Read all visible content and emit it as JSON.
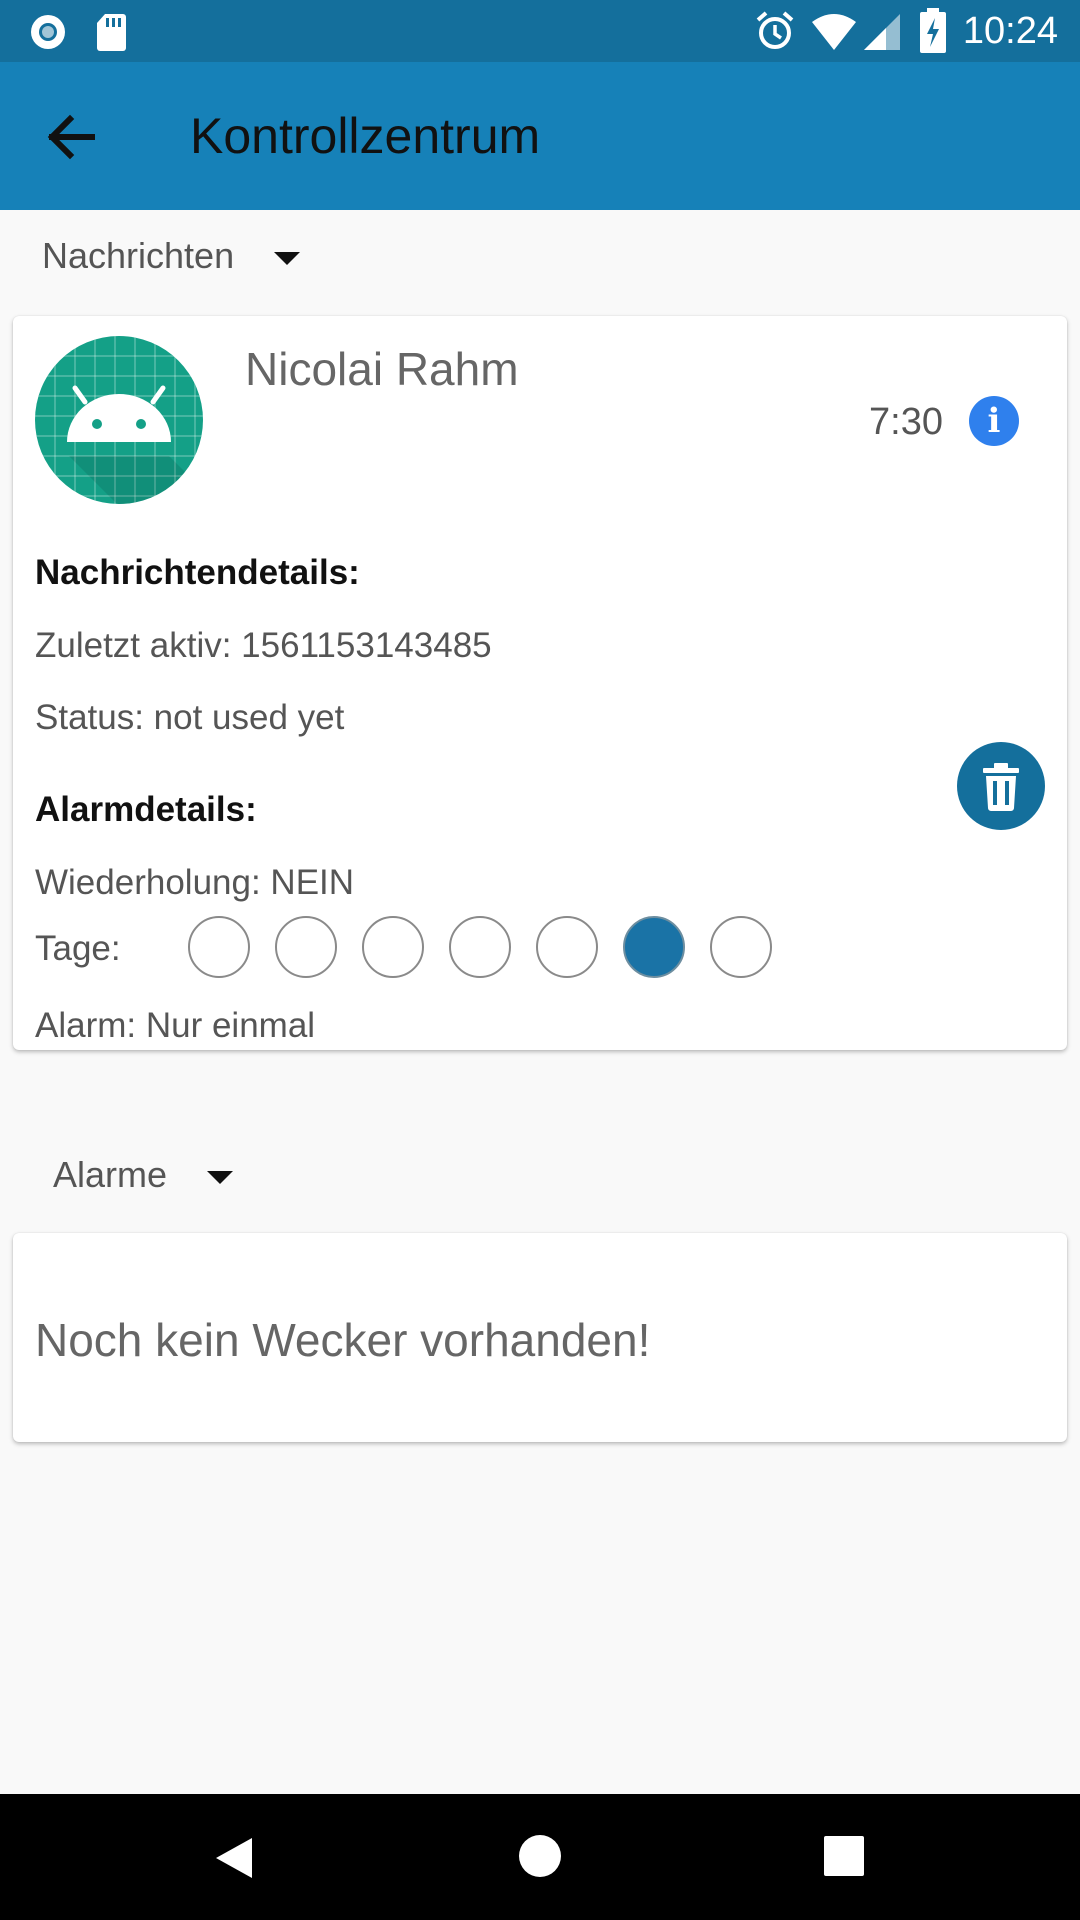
{
  "statusbar": {
    "time": "10:24"
  },
  "appbar": {
    "title": "Kontrollzentrum"
  },
  "sections": {
    "messages_label": "Nachrichten",
    "alarms_label": "Alarme"
  },
  "message": {
    "name": "Nicolai Rahm",
    "time": "7:30",
    "info_icon_glyph": "i",
    "details_heading": "Nachrichtendetails:",
    "last_active": "Zuletzt aktiv: 1561153143485",
    "status": "Status: not used yet",
    "alarm_heading": "Alarmdetails:",
    "repeat": "Wiederholung: NEIN",
    "days_label": "Tage:",
    "days_selected": [
      false,
      false,
      false,
      false,
      false,
      true,
      false
    ],
    "alarm_mode": "Alarm: Nur einmal"
  },
  "alarms": {
    "empty_text": "Noch kein Wecker vorhanden!"
  },
  "colors": {
    "statusbar": "#146f9c",
    "appbar": "#1681b8",
    "accent": "#1a73a6",
    "info": "#2f80ed",
    "avatar": "#14a087"
  },
  "icons": [
    "record-icon",
    "sd-card-icon",
    "alarm-clock-icon",
    "wifi-icon",
    "signal-icon",
    "battery-charging-icon",
    "back-arrow-icon",
    "android-avatar-icon",
    "info-icon",
    "trash-icon",
    "nav-back-icon",
    "nav-home-icon",
    "nav-recents-icon"
  ]
}
